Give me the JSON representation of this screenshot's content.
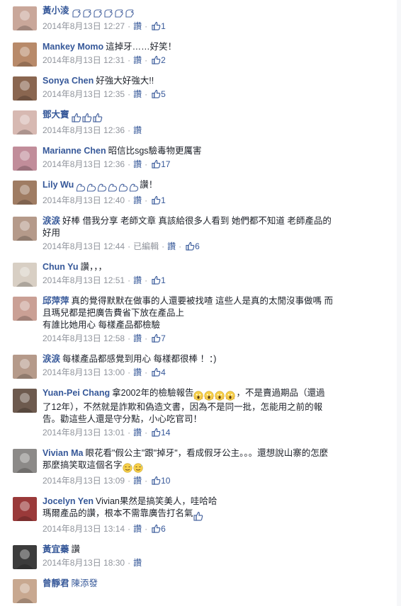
{
  "comments": [
    {
      "author": "黃小淩",
      "text": "",
      "emoji": "hand",
      "emoji_count": 6,
      "time": "2014年8月13日 12:27",
      "like_label": "讚",
      "likes": "1",
      "avatar_color": "#c9a79a"
    },
    {
      "author": "Mankey Momo",
      "text": "這掉牙……好笑！",
      "time": "2014年8月13日 12:31",
      "like_label": "讚",
      "likes": "2",
      "avatar_color": "#b88a6a"
    },
    {
      "author": "Sonya Chen",
      "text": "好強大好強大!!",
      "time": "2014年8月13日 12:35",
      "like_label": "讚",
      "likes": "5",
      "avatar_color": "#8a6650"
    },
    {
      "author": "鄧大寶",
      "text": "",
      "emoji": "thumb",
      "emoji_count": 3,
      "time": "2014年8月13日 12:36",
      "like_label": "讚",
      "likes": "",
      "avatar_color": "#d7b9b2"
    },
    {
      "author": "Marianne Chen",
      "text": "昭信比sgs驗毒物更厲害",
      "time": "2014年8月13日 12:36",
      "like_label": "讚",
      "likes": "17",
      "avatar_color": "#c18d9a"
    },
    {
      "author": "Lily Wu",
      "text": "讚！",
      "emoji": "muscle",
      "emoji_count": 6,
      "time": "2014年8月13日 12:40",
      "like_label": "讚",
      "likes": "1",
      "avatar_color": "#9f7c63"
    },
    {
      "author": "涙涙",
      "text": "好棒 借我分享 老師文章 真該給很多人看到 她們都不知道 老師產品的",
      "text2": "好用",
      "time": "2014年8月13日 12:44",
      "edited": "已編輯",
      "like_label": "讚",
      "likes": "6",
      "avatar_color": "#b59a8a"
    },
    {
      "author": "Chun Yu",
      "text": "讚，，，",
      "time": "2014年8月13日 12:51",
      "like_label": "讚",
      "likes": "1",
      "avatar_color": "#d8cfc4"
    },
    {
      "author": "邱萍萍",
      "text": "真的覺得默默在做事的人還要被找喳 這些人是真的太閒沒事做嗎 而",
      "text2": "且瑪兒都是把廣告費省下放在產品上",
      "text3": "有誰比她用心 每樣產品都檢驗",
      "time": "2014年8月13日 12:58",
      "like_label": "讚",
      "likes": "7",
      "avatar_color": "#caa095"
    },
    {
      "author": "涙涙",
      "text": "每樣產品都感覺到用心 每樣都很棒 ！：)",
      "time": "2014年8月13日 13:00",
      "like_label": "讚",
      "likes": "4",
      "avatar_color": "#b59a8a"
    },
    {
      "author": "Yuan-Pei Chang",
      "text": "拿2002年的檢驗報告",
      "emoji": "scream",
      "emoji_count": 4,
      "text_after": "，不是賣過期品（還過",
      "text2": "了12年），不然就是詐欺和偽造文書，因為不是同一批，怎能用之前的報",
      "text3": "告。勸這些人還是守分點，小心吃官司！",
      "time": "2014年8月13日 13:01",
      "like_label": "讚",
      "likes": "14",
      "avatar_color": "#6d5a4e"
    },
    {
      "author": "Vivian Ma",
      "text": "眼花看\"假公主\"跟\"掉牙\"，看成假牙公主。。。還想說山寨的怎麼",
      "text2": "那麼搞笑取這個名字",
      "emoji2": "sweat",
      "emoji2_count": 2,
      "time": "2014年8月13日 13:09",
      "like_label": "讚",
      "likes": "10",
      "avatar_color": "#8c8a88"
    },
    {
      "author": "Jocelyn Yen",
      "text": "Vivian果然是搞笑美人，哇哈哈",
      "text2": "瑪爾產品的讚，根本不需靠廣告打名氣",
      "emoji2": "thumb",
      "emoji2_count": 1,
      "time": "2014年8月13日 13:14",
      "like_label": "讚",
      "likes": "6",
      "avatar_color": "#9a3a3a"
    },
    {
      "author": "黃宜蓁",
      "text": "讚",
      "time": "2014年8月13日 18:30",
      "like_label": "讚",
      "likes": "",
      "avatar_color": "#3c3c3c"
    },
    {
      "author": "曾靜君",
      "text": "",
      "text_link": "陳添發",
      "time": "",
      "like_label": "",
      "likes": "",
      "avatar_color": "#c8a890"
    }
  ],
  "colors": {
    "link": "#365899",
    "meta": "#90949c",
    "text": "#1d2129"
  }
}
